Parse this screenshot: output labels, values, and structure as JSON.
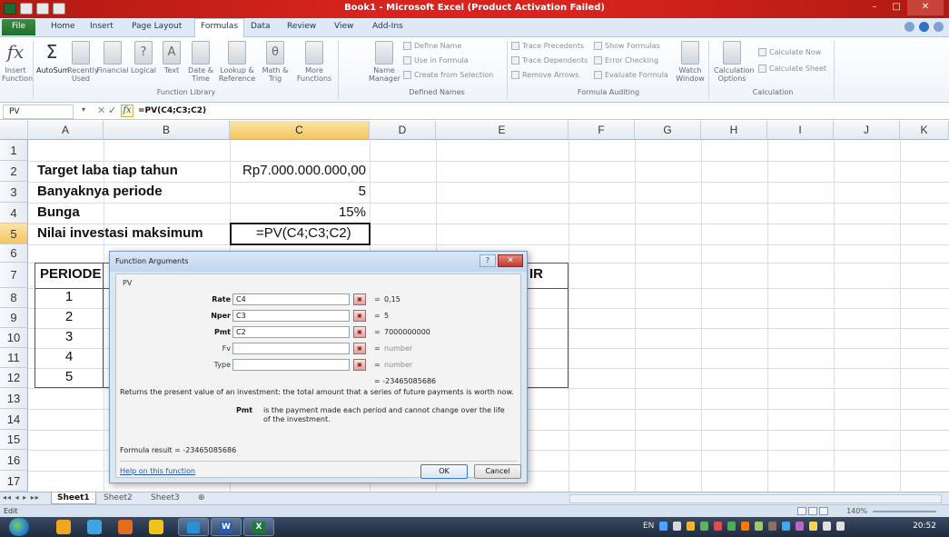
{
  "window": {
    "title": "Book1 - Microsoft Excel (Product Activation Failed)",
    "controls": [
      "–",
      "□",
      "✕"
    ]
  },
  "ribbon_tabs": [
    {
      "label": "File"
    },
    {
      "label": "Home"
    },
    {
      "label": "Insert"
    },
    {
      "label": "Page Layout"
    },
    {
      "label": "Formulas"
    },
    {
      "label": "Data"
    },
    {
      "label": "Review"
    },
    {
      "label": "View"
    },
    {
      "label": "Add-Ins"
    }
  ],
  "ribbon": {
    "insert_function": "Insert Function",
    "function_library": {
      "autosum": "AutoSum",
      "recently_used": "Recently Used",
      "financial": "Financial",
      "logical": "Logical",
      "text": "Text",
      "date_time": "Date & Time",
      "lookup": "Lookup & Reference",
      "math": "Math & Trig",
      "more": "More Functions",
      "group_label": "Function Library"
    },
    "defined_names": {
      "name_manager": "Name Manager",
      "define_name": "Define Name",
      "use_in_formula": "Use in Formula",
      "create_from_selection": "Create from Selection",
      "group_label": "Defined Names"
    },
    "formula_auditing": {
      "trace_precedents": "Trace Precedents",
      "trace_dependents": "Trace Dependents",
      "remove_arrows": "Remove Arrows",
      "show_formulas": "Show Formulas",
      "error_checking": "Error Checking",
      "evaluate_formula": "Evaluate Formula",
      "watch_window": "Watch Window",
      "group_label": "Formula Auditing"
    },
    "calculation": {
      "calc_options": "Calculation Options",
      "calculate_now": "Calculate Now",
      "calculate_sheet": "Calculate Sheet",
      "group_label": "Calculation"
    }
  },
  "formula_bar": {
    "name_box": "PV",
    "formula": "=PV(C4;C3;C2)"
  },
  "sheet": {
    "columns": [
      "A",
      "B",
      "C",
      "D",
      "E",
      "F",
      "G",
      "H",
      "I",
      "J",
      "K"
    ],
    "rows": [
      "1",
      "2",
      "3",
      "4",
      "5",
      "6",
      "7",
      "8",
      "9",
      "10",
      "11",
      "12",
      "13",
      "14",
      "15",
      "16",
      "17"
    ],
    "cells": {
      "A2": "Target laba tiap tahun",
      "C2": "Rp7.000.000.000,00",
      "A3": "Banyaknya periode",
      "C3": "5",
      "A4": "Bunga",
      "C4": "15%",
      "A5": "Nilai investasi maksimum",
      "C5": "=PV(C4;C3;C2)",
      "A7": "PERIODE",
      "E7": "IR",
      "A8": "1",
      "A9": "2",
      "A10": "3",
      "A11": "4",
      "A12": "5"
    }
  },
  "dialog": {
    "title": "Function Arguments",
    "help": "?",
    "close": "✕",
    "function_name": "PV",
    "args": [
      {
        "label": "Rate",
        "value": "C4",
        "result": "0,15",
        "required": true
      },
      {
        "label": "Nper",
        "value": "C3",
        "result": "5",
        "required": true
      },
      {
        "label": "Pmt",
        "value": "C2",
        "result": "7000000000",
        "required": true
      },
      {
        "label": "Fv",
        "value": "",
        "result": "number",
        "required": false
      },
      {
        "label": "Type",
        "value": "",
        "result": "number",
        "required": false
      }
    ],
    "equals": "=",
    "total": "= -23465085686",
    "description": "Returns the present value of an investment: the total amount that a series of future payments is worth now.",
    "param_name": "Pmt",
    "param_desc": "is the payment made each period and cannot change over the life of the investment.",
    "formula_result": "Formula result =  -23465085686",
    "help_link": "Help on this function",
    "ok": "OK",
    "cancel": "Cancel"
  },
  "sheet_tabs": [
    "Sheet1",
    "Sheet2",
    "Sheet3"
  ],
  "status": {
    "mode": "Edit",
    "zoom": "140%"
  },
  "taskbar": {
    "language": "EN",
    "clock": "20:52"
  },
  "colors": {
    "title_bar": "#d8241c",
    "file_tab": "#2e7d38",
    "selection_header": "#f4c65e",
    "taskbar": "#2a3850"
  }
}
